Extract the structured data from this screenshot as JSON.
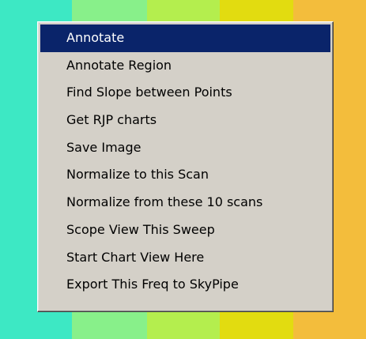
{
  "background": {
    "bands": [
      "#3de8c4",
      "#88f08a",
      "#b4ee4e",
      "#e2dc10",
      "#f3bd3c"
    ]
  },
  "menu": {
    "highlight_color": "#0a246a",
    "items": [
      {
        "label": "Annotate",
        "highlighted": true
      },
      {
        "label": "Annotate Region",
        "highlighted": false
      },
      {
        "label": "Find Slope between Points",
        "highlighted": false
      },
      {
        "label": "Get RJP charts",
        "highlighted": false
      },
      {
        "label": "Save Image",
        "highlighted": false
      },
      {
        "label": "Normalize to this Scan",
        "highlighted": false
      },
      {
        "label": "Normalize from these 10 scans",
        "highlighted": false
      },
      {
        "label": "Scope View This Sweep",
        "highlighted": false
      },
      {
        "label": "Start Chart View Here",
        "highlighted": false
      },
      {
        "label": "Export This Freq to SkyPipe",
        "highlighted": false
      }
    ]
  }
}
